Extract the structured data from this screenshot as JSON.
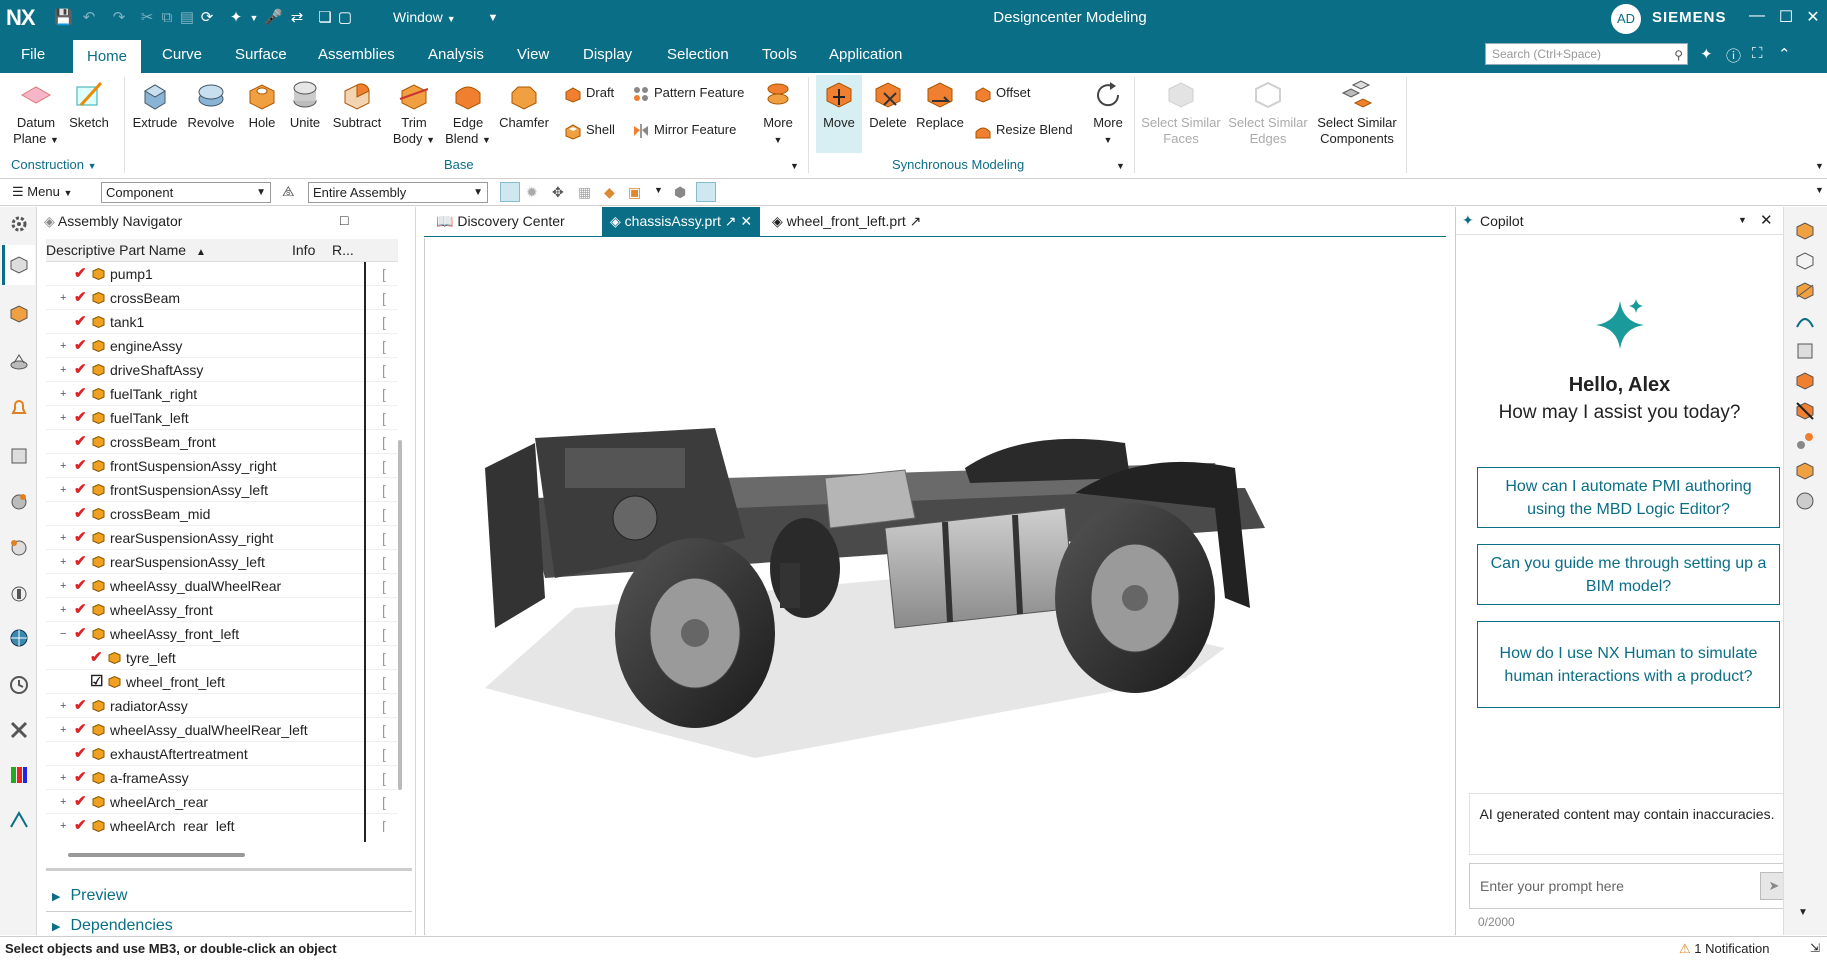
{
  "titlebar": {
    "logo": "NX",
    "window_menu": "Window",
    "app_title": "Designcenter Modeling",
    "avatar_initials": "AD",
    "brand": "SIEMENS"
  },
  "tabs": [
    "File",
    "Home",
    "Curve",
    "Surface",
    "Assemblies",
    "Analysis",
    "View",
    "Display",
    "Selection",
    "Tools",
    "Application"
  ],
  "active_tab": "Home",
  "search": {
    "placeholder": "Search (Ctrl+Space)"
  },
  "ribbon": {
    "datum_plane": "Datum Plane",
    "sketch": "Sketch",
    "construction": "Construction",
    "extrude": "Extrude",
    "revolve": "Revolve",
    "hole": "Hole",
    "unite": "Unite",
    "subtract": "Subtract",
    "trim_body": "Trim Body",
    "edge_blend": "Edge Blend",
    "chamfer": "Chamfer",
    "draft": "Draft",
    "shell": "Shell",
    "pattern_feature": "Pattern Feature",
    "mirror_feature": "Mirror Feature",
    "more": "More",
    "base": "Base",
    "move": "Move",
    "delete": "Delete",
    "replace": "Replace",
    "offset": "Offset",
    "resize_blend": "Resize Blend",
    "synchronous_modeling": "Synchronous Modeling",
    "select_similar_faces": "Select Similar Faces",
    "select_similar_edges": "Select Similar Edges",
    "select_similar_components": "Select Similar Components"
  },
  "selbar": {
    "menu": "Menu",
    "filter": "Component",
    "scope": "Entire Assembly"
  },
  "navigator": {
    "title": "Assembly Navigator",
    "columns": [
      "Descriptive Part Name",
      "Info",
      "R..."
    ],
    "rows": [
      {
        "name": "pump1",
        "exp": "",
        "level": 1
      },
      {
        "name": "crossBeam",
        "exp": "+",
        "level": 1
      },
      {
        "name": "tank1",
        "exp": "",
        "level": 1
      },
      {
        "name": "engineAssy",
        "exp": "+",
        "level": 1
      },
      {
        "name": "driveShaftAssy",
        "exp": "+",
        "level": 1
      },
      {
        "name": "fuelTank_right",
        "exp": "+",
        "level": 1
      },
      {
        "name": "fuelTank_left",
        "exp": "+",
        "level": 1
      },
      {
        "name": "crossBeam_front",
        "exp": "",
        "level": 1
      },
      {
        "name": "frontSuspensionAssy_right",
        "exp": "+",
        "level": 1
      },
      {
        "name": "frontSuspensionAssy_left",
        "exp": "+",
        "level": 1
      },
      {
        "name": "crossBeam_mid",
        "exp": "",
        "level": 1
      },
      {
        "name": "rearSuspensionAssy_right",
        "exp": "+",
        "level": 1
      },
      {
        "name": "rearSuspensionAssy_left",
        "exp": "+",
        "level": 1
      },
      {
        "name": "wheelAssy_dualWheelRear",
        "exp": "+",
        "level": 1
      },
      {
        "name": "wheelAssy_front",
        "exp": "+",
        "level": 1
      },
      {
        "name": "wheelAssy_front_left",
        "exp": "−",
        "level": 1
      },
      {
        "name": "tyre_left",
        "exp": "",
        "level": 2
      },
      {
        "name": "wheel_front_left",
        "exp": "",
        "level": 2,
        "box": true
      },
      {
        "name": "radiatorAssy",
        "exp": "+",
        "level": 1
      },
      {
        "name": "wheelAssy_dualWheelRear_left",
        "exp": "+",
        "level": 1
      },
      {
        "name": "exhaustAftertreatment",
        "exp": "",
        "level": 1
      },
      {
        "name": "a-frameAssy",
        "exp": "+",
        "level": 1
      },
      {
        "name": "wheelArch_rear",
        "exp": "+",
        "level": 1
      },
      {
        "name": "wheelArch_rear_left",
        "exp": "+",
        "level": 1
      }
    ],
    "preview": "Preview",
    "dependencies": "Dependencies"
  },
  "doc_tabs": [
    "Discovery Center",
    "chassisAssy.prt",
    "wheel_front_left.prt"
  ],
  "active_doc": "chassisAssy.prt",
  "copilot": {
    "title": "Copilot",
    "greeting": "Hello, Alex",
    "question": "How may I assist you today?",
    "suggestions": [
      "How can I automate PMI authoring using the MBD Logic Editor?",
      "Can you guide me through setting up a BIM model?",
      "How do I use NX Human to simulate human interactions with a product?"
    ],
    "disclaimer": "AI generated content may contain inaccuracies.",
    "input_placeholder": "Enter your prompt here",
    "char_count": "0/2000"
  },
  "status": {
    "message": "Select objects and use MB3, or double-click an object",
    "notification": "1 Notification"
  },
  "colors": {
    "accent": "#0b6e87",
    "check": "#d22222",
    "cube": "#f0a020"
  }
}
